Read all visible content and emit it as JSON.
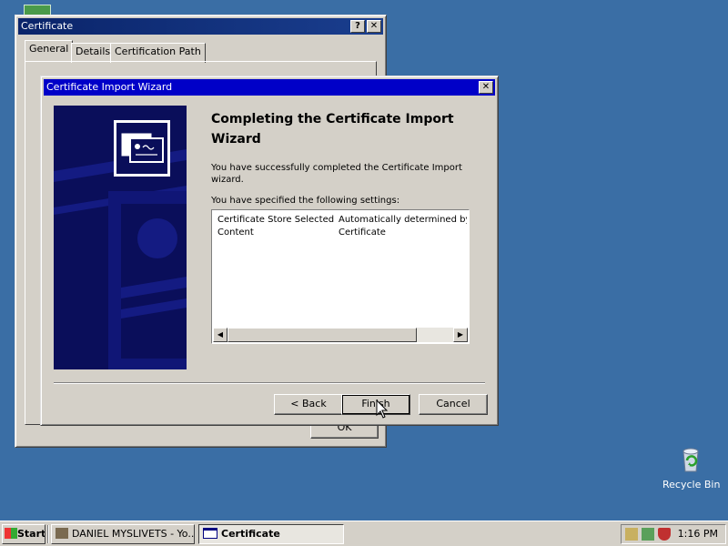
{
  "desktop": {
    "recycle_bin_label": "Recycle Bin"
  },
  "cert_window": {
    "title": "Certificate",
    "help_glyph": "?",
    "close_glyph": "✕",
    "tabs": [
      "General",
      "Details",
      "Certification Path"
    ],
    "ok_label": "OK"
  },
  "wizard": {
    "title": "Certificate Import Wizard",
    "close_glyph": "✕",
    "heading": "Completing the Certificate Import Wizard",
    "success_text": "You have successfully completed the Certificate Import wizard.",
    "settings_label": "You have specified the following settings:",
    "settings": [
      {
        "name": "Certificate Store Selected",
        "value": "Automatically determined by t"
      },
      {
        "name": "Content",
        "value": "Certificate"
      }
    ],
    "back_label": "< Back",
    "finish_label": "Finish",
    "cancel_label": "Cancel",
    "scroll_left_glyph": "◀",
    "scroll_right_glyph": "▶"
  },
  "taskbar": {
    "start_label": "Start",
    "tasks": [
      {
        "label": "DANIEL MYSLIVETS - Yo..."
      },
      {
        "label": "Certificate"
      }
    ],
    "clock": "1:16 PM"
  },
  "colors": {
    "desktop": "#3a6ea5",
    "titlebar_active_start": "#0a246a",
    "titlebar_active_end": "#a6caf0",
    "titlebar_inactive": "#808080",
    "face": "#d4d0c8",
    "wizard_banner": "#0a0e5a"
  }
}
